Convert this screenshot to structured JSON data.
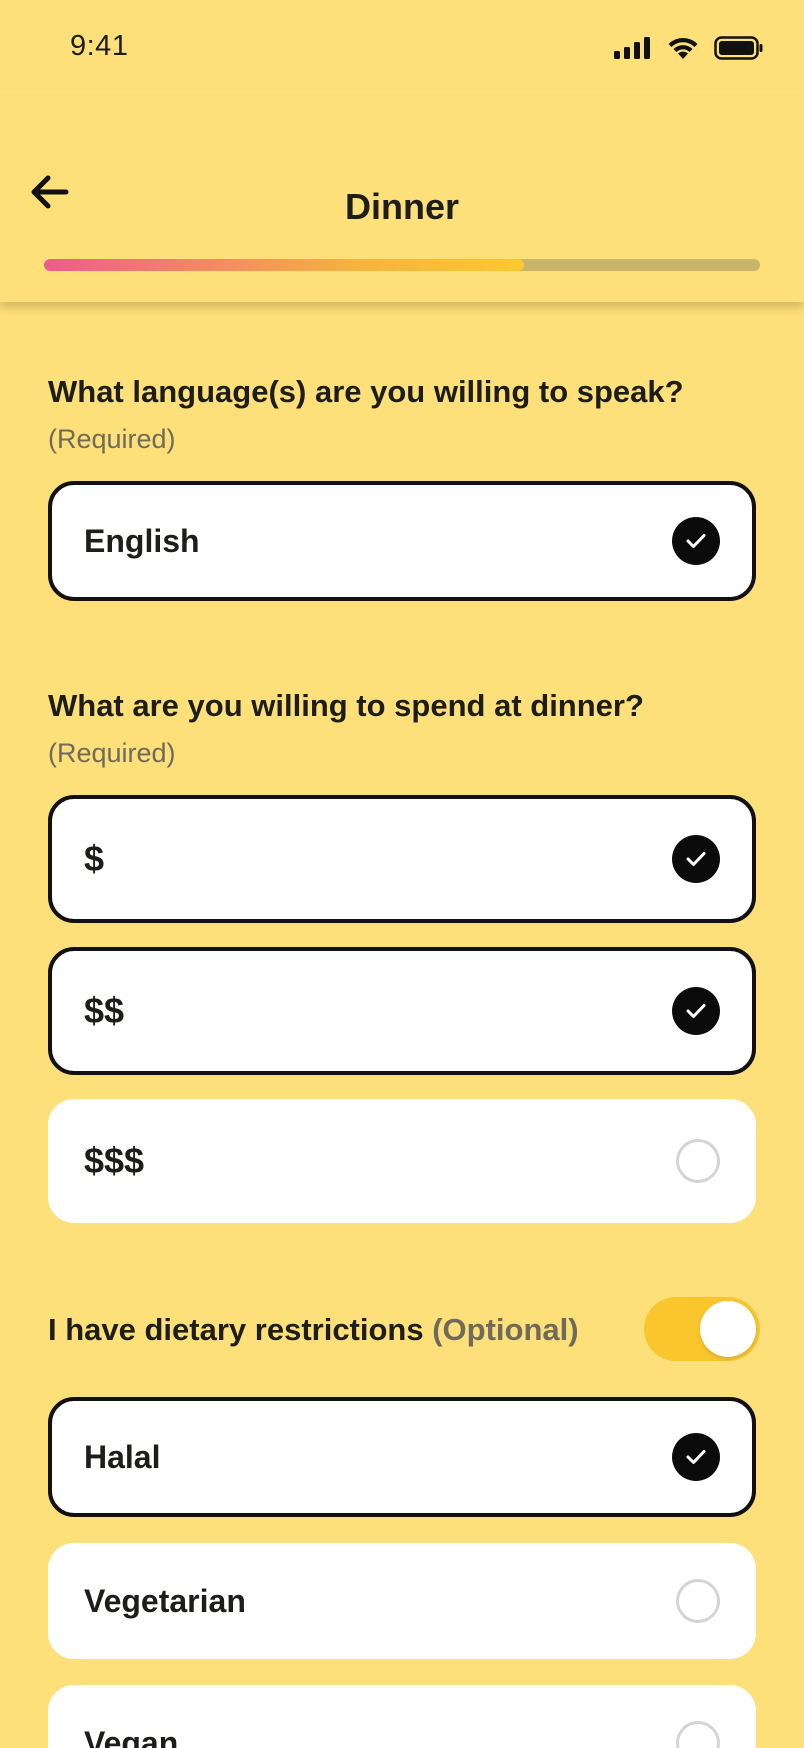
{
  "status_bar": {
    "time": "9:41"
  },
  "header": {
    "title": "Dinner",
    "progress": 0.67
  },
  "language_question": {
    "title": "What language(s) are you willing to speak?",
    "required": "(Required)",
    "options": [
      {
        "label": "English",
        "selected": true
      }
    ]
  },
  "spend_question": {
    "title": "What are you willing to spend at dinner?",
    "required": "(Required)",
    "options": [
      {
        "label": "$",
        "selected": true
      },
      {
        "label": "$$",
        "selected": true
      },
      {
        "label": "$$$",
        "selected": false
      }
    ]
  },
  "dietary": {
    "label": "I have dietary restrictions",
    "optional": "(Optional)",
    "toggle_on": true,
    "options": [
      {
        "label": "Halal",
        "selected": true
      },
      {
        "label": "Vegetarian",
        "selected": false
      },
      {
        "label": "Vegan",
        "selected": false
      }
    ]
  },
  "colors": {
    "background": "#FDE07A",
    "accent_yellow": "#F9C62E",
    "progress_start": "#EF5A8E",
    "progress_end": "#FCC92E",
    "check": "#0B0B0B"
  },
  "icons": {
    "back": "arrow-left-icon",
    "selected": "check-circle-icon",
    "unselected": "empty-radio-icon"
  }
}
